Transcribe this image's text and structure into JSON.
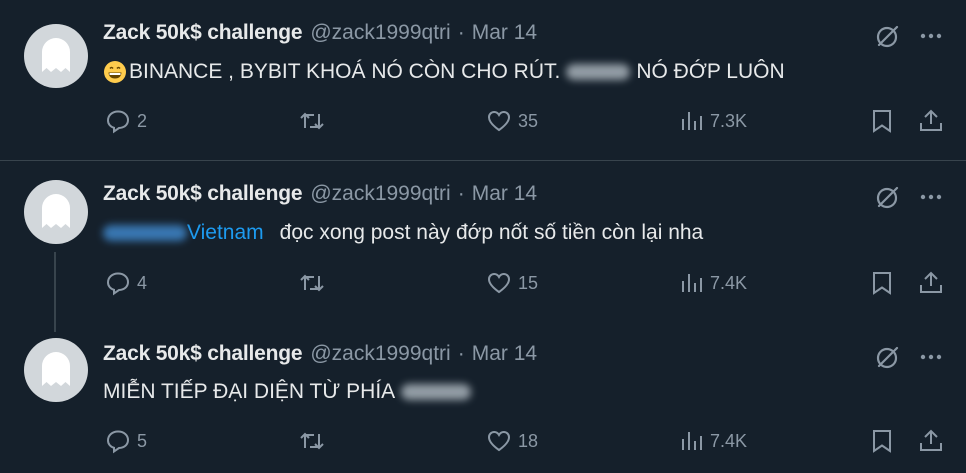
{
  "user": {
    "name": "Zack 50k$ challenge",
    "handle": "@zack1999qtri",
    "separator": "·"
  },
  "tweets": [
    {
      "date": "Mar 14",
      "text_before": "BINANCE , BYBIT KHOÁ NÓ CÒN CHO RÚT.",
      "text_after": "NÓ ĐỚP LUÔN",
      "replies": "2",
      "reposts": "",
      "likes": "35",
      "views": "7.3K"
    },
    {
      "date": "Mar 14",
      "mention_suffix": "Vietnam",
      "text": "đọc xong post này đớp nốt số tiền còn lại nha",
      "replies": "4",
      "reposts": "",
      "likes": "15",
      "views": "7.4K"
    },
    {
      "date": "Mar 14",
      "text_before": "MIỄN TIẾP ĐẠI DIỆN TỪ PHÍA",
      "replies": "5",
      "reposts": "",
      "likes": "18",
      "views": "7.4K"
    }
  ],
  "icons": {
    "reply": "reply-icon",
    "repost": "repost-icon",
    "like": "heart-icon",
    "views": "views-icon",
    "bookmark": "bookmark-icon",
    "share": "share-icon",
    "grok": "grok-icon",
    "more": "more-icon",
    "emoji": "grinning-emoji"
  },
  "colors": {
    "background": "#15202b",
    "text": "#e7e9ea",
    "muted": "#8b98a5",
    "link": "#1d9bf0",
    "divider": "#38444d"
  }
}
